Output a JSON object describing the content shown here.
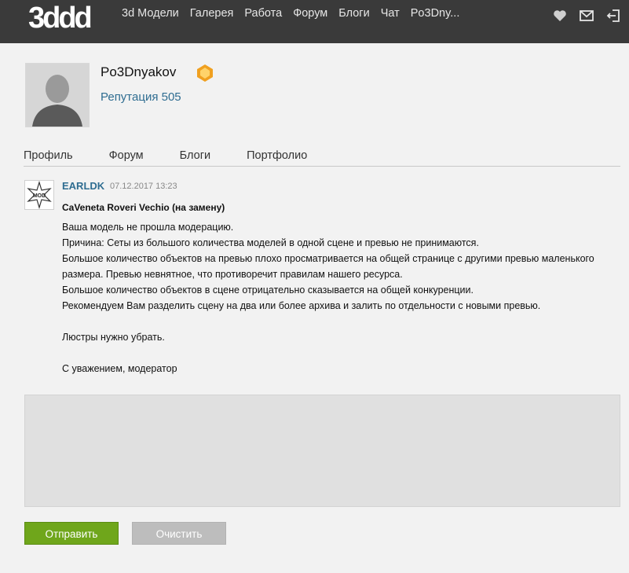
{
  "header": {
    "logo": "3ddd",
    "nav": [
      "3d Модели",
      "Галерея",
      "Работа",
      "Форум",
      "Блоги",
      "Чат",
      "Po3Dny..."
    ],
    "icons": [
      "heart-icon",
      "mail-icon",
      "logout-icon"
    ]
  },
  "profile": {
    "username": "Po3Dnyakov",
    "reputation": "Репутация 505",
    "tabs": [
      "Профиль",
      "Форум",
      "Блоги",
      "Портфолио"
    ]
  },
  "message": {
    "avatar_text": "MOD",
    "author": "EARLDK",
    "date": "07.12.2017 13:23",
    "subject": "CaVeneta Roveri Vechio (на замену)",
    "lines": [
      "Ваша модель не прошла модерацию.",
      "Причина: Сеты из большого количества моделей в одной сцене и превью не принимаются.",
      "Большое количество объектов на превью плохо просматривается на общей странице с другими превью маленького размера. Превью невнятное, что противоречит правилам нашего ресурса.",
      "Большое количество объектов в сцене отрицательно сказывается на общей конкуренции.",
      "Рекомендуем Вам разделить сцену на два или более архива и залить по отдельности с новыми превью.",
      "",
      "Люстры нужно убрать.",
      "",
      "С уважением, модератор"
    ]
  },
  "reply": {
    "value": ""
  },
  "buttons": {
    "send": "Отправить",
    "clear": "Очистить"
  },
  "colors": {
    "topbar": "#3a3a3a",
    "link": "#2f6d91",
    "send": "#6fa61b",
    "clear": "#bdbdbd"
  }
}
